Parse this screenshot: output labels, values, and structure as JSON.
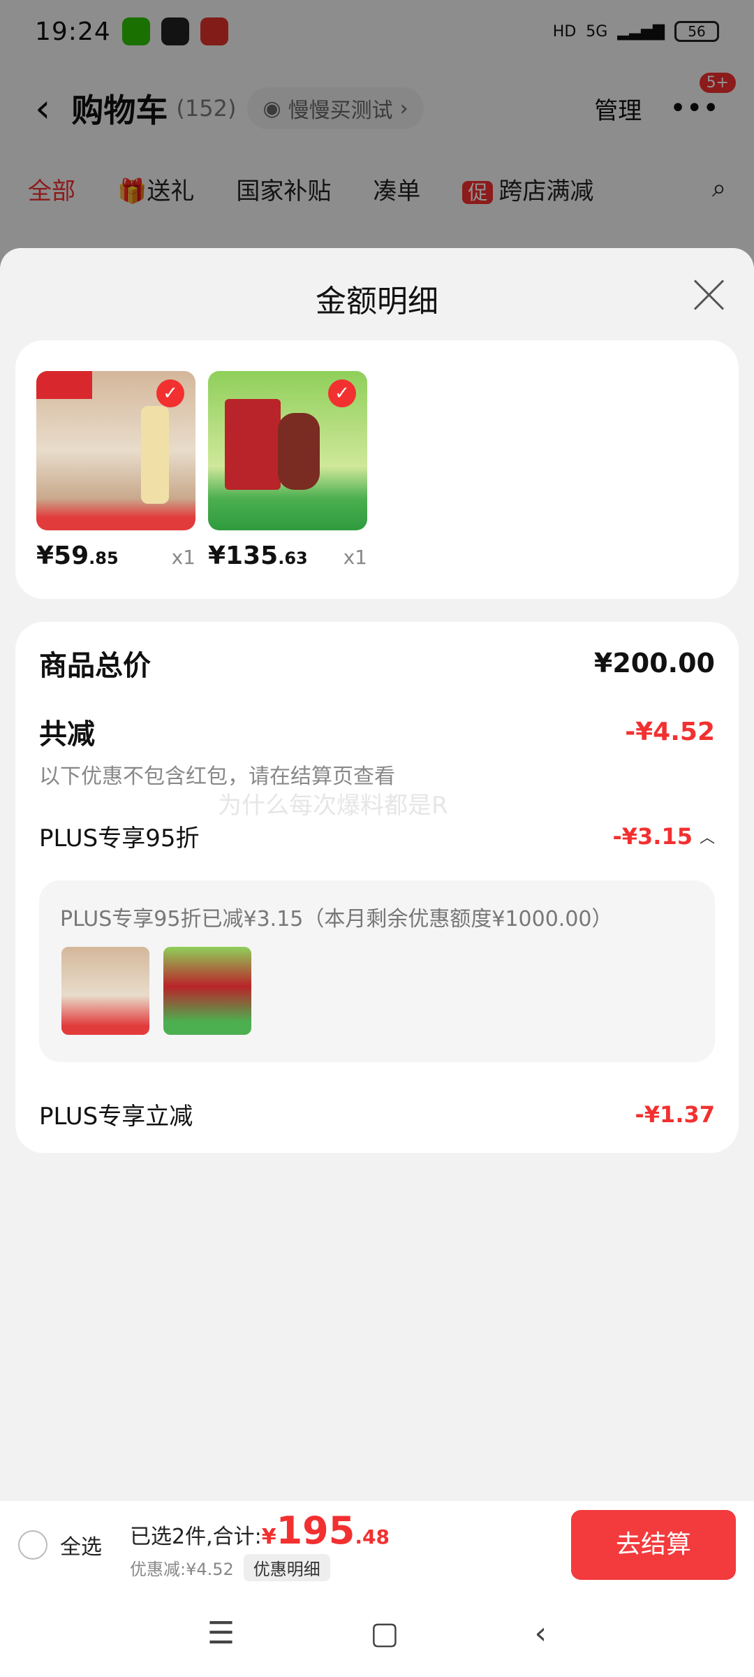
{
  "status_bar": {
    "time": "19:24",
    "network": "5G",
    "hd": "HD",
    "battery": "56"
  },
  "nav": {
    "back_icon": "‹",
    "title": "购物车",
    "count": "(152)",
    "chip": "慢慢买测试",
    "manage": "管理",
    "more": "•••",
    "badge": "5+"
  },
  "tabs": [
    {
      "label": "全部"
    },
    {
      "label": "送礼"
    },
    {
      "label": "国家补贴"
    },
    {
      "label": "凑单"
    },
    {
      "label": "跨店满减",
      "icon_label": "促"
    }
  ],
  "sheet": {
    "title": "金额明细",
    "products": [
      {
        "price_int": "¥59",
        "price_dec": ".85",
        "qty": "x1"
      },
      {
        "price_int": "¥135",
        "price_dec": ".63",
        "qty": "x1"
      }
    ],
    "total_label": "商品总价",
    "total_value": "¥200.00",
    "reduce_label": "共减",
    "reduce_value": "-¥4.52",
    "reduce_note": "以下优惠不包含红包，请在结算页查看",
    "watermark": "为什么每次爆料都是R",
    "plus95_label": "PLUS专享95折",
    "plus95_value": "-¥3.15",
    "plus95_note": "PLUS专享95折已减¥3.15（本月剩余优惠额度¥1000.00）",
    "plus_instant_label": "PLUS专享立减",
    "plus_instant_value": "-¥1.37"
  },
  "bottom_bar": {
    "select_all": "全选",
    "selected_prefix": "已选2件,合计:",
    "currency": "¥",
    "amount_int": "195",
    "amount_dec": ".48",
    "discount_text": "优惠减:¥4.52",
    "detail_chip": "优惠明细",
    "checkout": "去结算"
  },
  "system_nav": {
    "menu": "☰",
    "home": "▢",
    "back": "‹"
  },
  "colors": {
    "accent": "#f23030",
    "checkout": "#f33a3d"
  }
}
